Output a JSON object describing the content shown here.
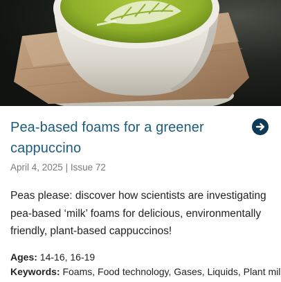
{
  "article": {
    "image_alt": "Matcha latte with latte art on a saucer",
    "title": "Pea-based foams for a greener cappuccino",
    "date": "April 4, 2025",
    "separator": " | ",
    "issue": "Issue 72",
    "description": "Peas please: discover how scientists are investigating pea-based ‘milk’ foams for delicious, environmentally friendly, plant-based cappuccinos!",
    "ages_label": "Ages:",
    "ages_value": " 14-16, 16-19",
    "keywords_label": "Keywords:",
    "keywords_value": " Foams, Food technology, Gases, Liquids, Plant milk,"
  },
  "icons": {
    "arrow": "arrow-right-circle-icon"
  },
  "colors": {
    "title": "#1b5b7e",
    "arrow_bg": "#0e3a58",
    "meta": "#7a7a7a",
    "text": "#222222"
  }
}
